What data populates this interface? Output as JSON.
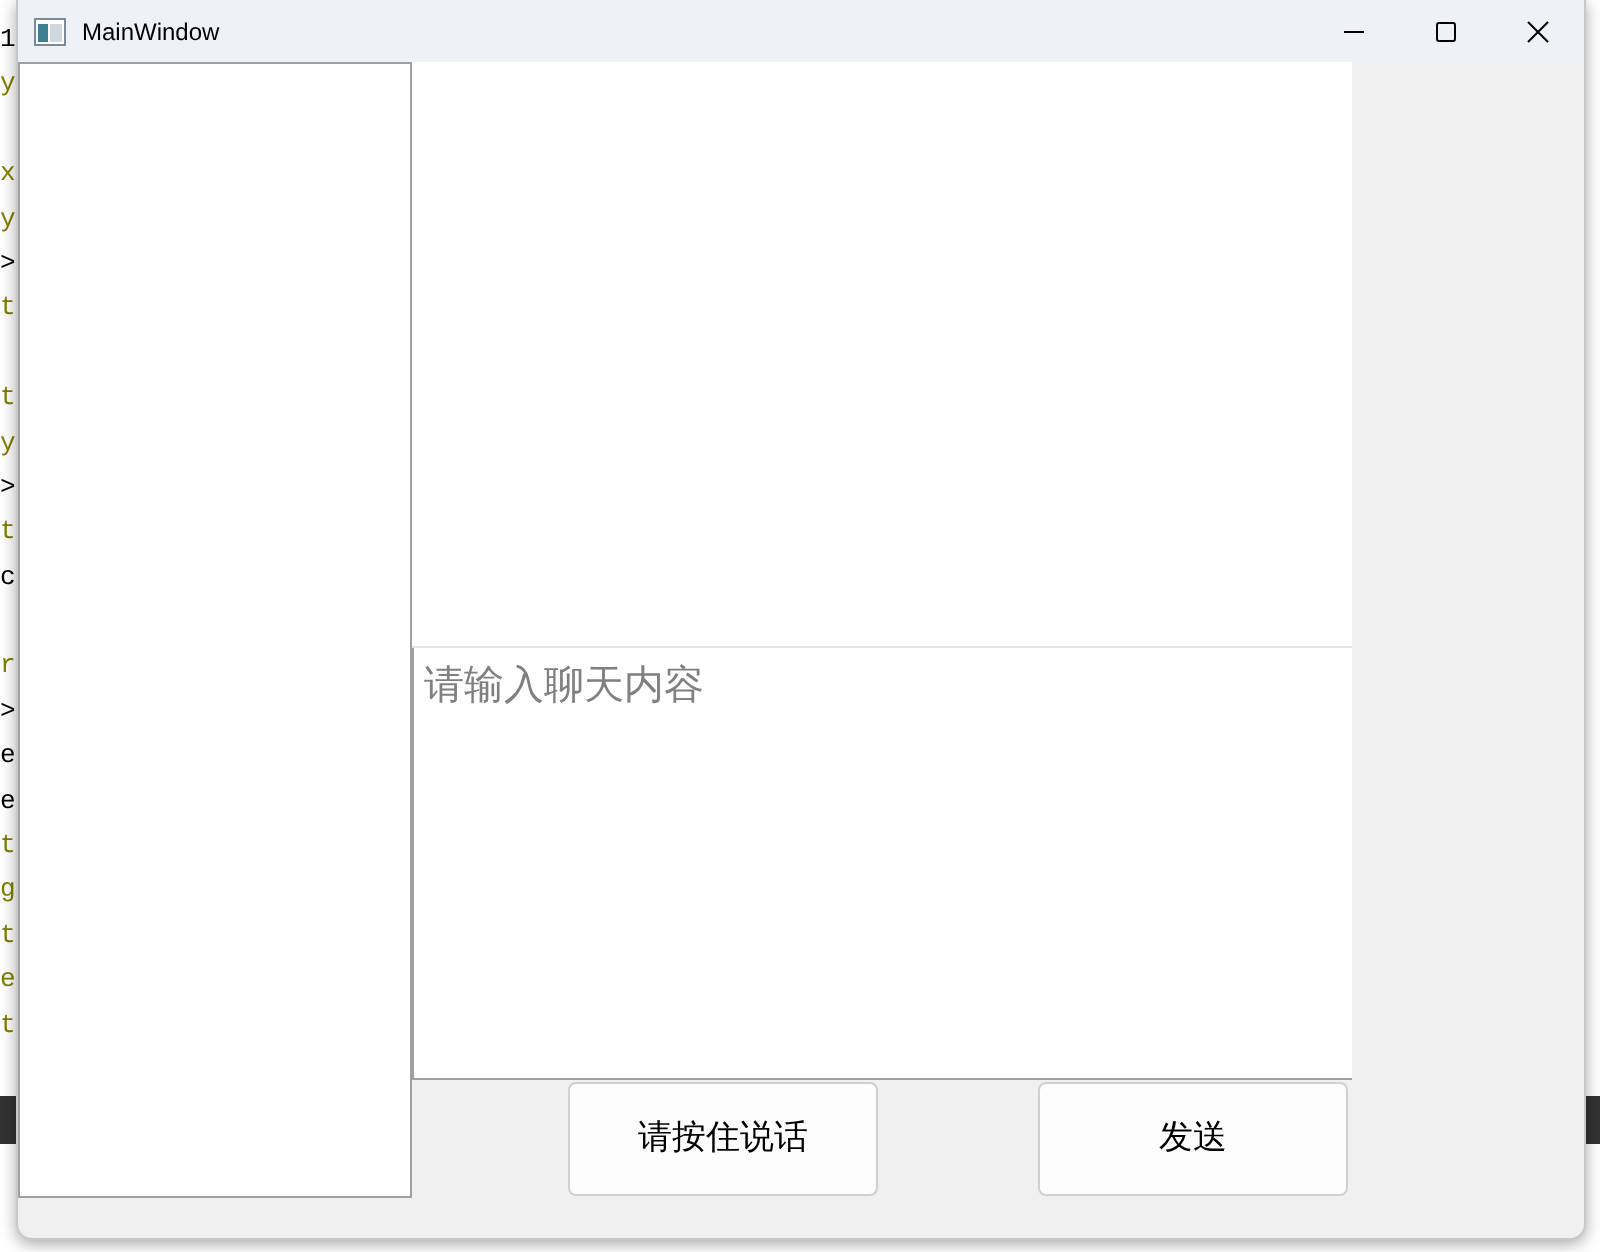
{
  "background_editor": {
    "lines": [
      {
        "kind": "code",
        "text": "1",
        "color": "#000000"
      },
      {
        "kind": "code",
        "text": "y",
        "color": "#808000"
      },
      {
        "kind": "blank"
      },
      {
        "kind": "code",
        "text": "x",
        "color": "#808000"
      },
      {
        "kind": "code",
        "text": "y",
        "color": "#808000"
      },
      {
        "kind": "code",
        "text": ">",
        "color": "#000000"
      },
      {
        "kind": "code",
        "text": "t",
        "color": "#808000"
      },
      {
        "kind": "blank"
      },
      {
        "kind": "code",
        "text": "t",
        "color": "#808000"
      },
      {
        "kind": "code",
        "text": "y",
        "color": "#808000"
      },
      {
        "kind": "code",
        "text": ">",
        "color": "#000000"
      },
      {
        "kind": "code",
        "text": "t",
        "color": "#808000"
      },
      {
        "kind": "code",
        "text": "c",
        "color": "#000000"
      },
      {
        "kind": "blank"
      },
      {
        "kind": "code",
        "text": "r",
        "color": "#808000"
      },
      {
        "kind": "code",
        "text": ">",
        "color": "#000000"
      },
      {
        "kind": "code",
        "text": "e",
        "color": "#000000"
      },
      {
        "kind": "code",
        "text": "e",
        "color": "#000000"
      },
      {
        "kind": "code",
        "text": "t",
        "color": "#808000"
      },
      {
        "kind": "code",
        "text": "g",
        "color": "#808000"
      },
      {
        "kind": "code",
        "text": "t",
        "color": "#808000"
      },
      {
        "kind": "code",
        "text": "e",
        "color": "#808000"
      },
      {
        "kind": "code",
        "text": "t",
        "color": "#808000"
      }
    ]
  },
  "window": {
    "title": "MainWindow"
  },
  "chat": {
    "input": {
      "placeholder": "请输入聊天内容"
    }
  },
  "buttons": [
    {
      "label": "请按住说话"
    },
    {
      "label": "发送"
    }
  ]
}
